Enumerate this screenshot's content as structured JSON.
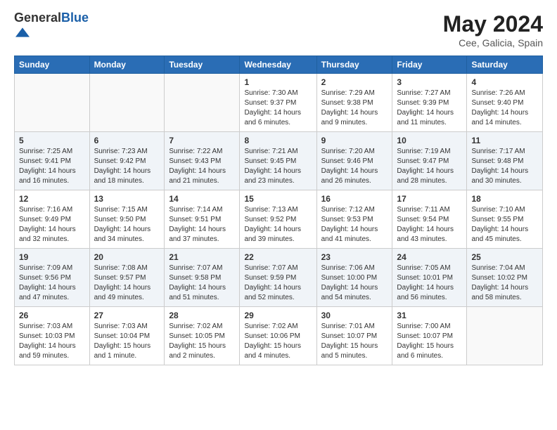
{
  "header": {
    "logo_general": "General",
    "logo_blue": "Blue",
    "main_title": "May 2024",
    "subtitle": "Cee, Galicia, Spain"
  },
  "days_of_week": [
    "Sunday",
    "Monday",
    "Tuesday",
    "Wednesday",
    "Thursday",
    "Friday",
    "Saturday"
  ],
  "weeks": [
    [
      {
        "day": "",
        "info": ""
      },
      {
        "day": "",
        "info": ""
      },
      {
        "day": "",
        "info": ""
      },
      {
        "day": "1",
        "info": "Sunrise: 7:30 AM\nSunset: 9:37 PM\nDaylight: 14 hours\nand 6 minutes."
      },
      {
        "day": "2",
        "info": "Sunrise: 7:29 AM\nSunset: 9:38 PM\nDaylight: 14 hours\nand 9 minutes."
      },
      {
        "day": "3",
        "info": "Sunrise: 7:27 AM\nSunset: 9:39 PM\nDaylight: 14 hours\nand 11 minutes."
      },
      {
        "day": "4",
        "info": "Sunrise: 7:26 AM\nSunset: 9:40 PM\nDaylight: 14 hours\nand 14 minutes."
      }
    ],
    [
      {
        "day": "5",
        "info": "Sunrise: 7:25 AM\nSunset: 9:41 PM\nDaylight: 14 hours\nand 16 minutes."
      },
      {
        "day": "6",
        "info": "Sunrise: 7:23 AM\nSunset: 9:42 PM\nDaylight: 14 hours\nand 18 minutes."
      },
      {
        "day": "7",
        "info": "Sunrise: 7:22 AM\nSunset: 9:43 PM\nDaylight: 14 hours\nand 21 minutes."
      },
      {
        "day": "8",
        "info": "Sunrise: 7:21 AM\nSunset: 9:45 PM\nDaylight: 14 hours\nand 23 minutes."
      },
      {
        "day": "9",
        "info": "Sunrise: 7:20 AM\nSunset: 9:46 PM\nDaylight: 14 hours\nand 26 minutes."
      },
      {
        "day": "10",
        "info": "Sunrise: 7:19 AM\nSunset: 9:47 PM\nDaylight: 14 hours\nand 28 minutes."
      },
      {
        "day": "11",
        "info": "Sunrise: 7:17 AM\nSunset: 9:48 PM\nDaylight: 14 hours\nand 30 minutes."
      }
    ],
    [
      {
        "day": "12",
        "info": "Sunrise: 7:16 AM\nSunset: 9:49 PM\nDaylight: 14 hours\nand 32 minutes."
      },
      {
        "day": "13",
        "info": "Sunrise: 7:15 AM\nSunset: 9:50 PM\nDaylight: 14 hours\nand 34 minutes."
      },
      {
        "day": "14",
        "info": "Sunrise: 7:14 AM\nSunset: 9:51 PM\nDaylight: 14 hours\nand 37 minutes."
      },
      {
        "day": "15",
        "info": "Sunrise: 7:13 AM\nSunset: 9:52 PM\nDaylight: 14 hours\nand 39 minutes."
      },
      {
        "day": "16",
        "info": "Sunrise: 7:12 AM\nSunset: 9:53 PM\nDaylight: 14 hours\nand 41 minutes."
      },
      {
        "day": "17",
        "info": "Sunrise: 7:11 AM\nSunset: 9:54 PM\nDaylight: 14 hours\nand 43 minutes."
      },
      {
        "day": "18",
        "info": "Sunrise: 7:10 AM\nSunset: 9:55 PM\nDaylight: 14 hours\nand 45 minutes."
      }
    ],
    [
      {
        "day": "19",
        "info": "Sunrise: 7:09 AM\nSunset: 9:56 PM\nDaylight: 14 hours\nand 47 minutes."
      },
      {
        "day": "20",
        "info": "Sunrise: 7:08 AM\nSunset: 9:57 PM\nDaylight: 14 hours\nand 49 minutes."
      },
      {
        "day": "21",
        "info": "Sunrise: 7:07 AM\nSunset: 9:58 PM\nDaylight: 14 hours\nand 51 minutes."
      },
      {
        "day": "22",
        "info": "Sunrise: 7:07 AM\nSunset: 9:59 PM\nDaylight: 14 hours\nand 52 minutes."
      },
      {
        "day": "23",
        "info": "Sunrise: 7:06 AM\nSunset: 10:00 PM\nDaylight: 14 hours\nand 54 minutes."
      },
      {
        "day": "24",
        "info": "Sunrise: 7:05 AM\nSunset: 10:01 PM\nDaylight: 14 hours\nand 56 minutes."
      },
      {
        "day": "25",
        "info": "Sunrise: 7:04 AM\nSunset: 10:02 PM\nDaylight: 14 hours\nand 58 minutes."
      }
    ],
    [
      {
        "day": "26",
        "info": "Sunrise: 7:03 AM\nSunset: 10:03 PM\nDaylight: 14 hours\nand 59 minutes."
      },
      {
        "day": "27",
        "info": "Sunrise: 7:03 AM\nSunset: 10:04 PM\nDaylight: 15 hours\nand 1 minute."
      },
      {
        "day": "28",
        "info": "Sunrise: 7:02 AM\nSunset: 10:05 PM\nDaylight: 15 hours\nand 2 minutes."
      },
      {
        "day": "29",
        "info": "Sunrise: 7:02 AM\nSunset: 10:06 PM\nDaylight: 15 hours\nand 4 minutes."
      },
      {
        "day": "30",
        "info": "Sunrise: 7:01 AM\nSunset: 10:07 PM\nDaylight: 15 hours\nand 5 minutes."
      },
      {
        "day": "31",
        "info": "Sunrise: 7:00 AM\nSunset: 10:07 PM\nDaylight: 15 hours\nand 6 minutes."
      },
      {
        "day": "",
        "info": ""
      }
    ]
  ]
}
